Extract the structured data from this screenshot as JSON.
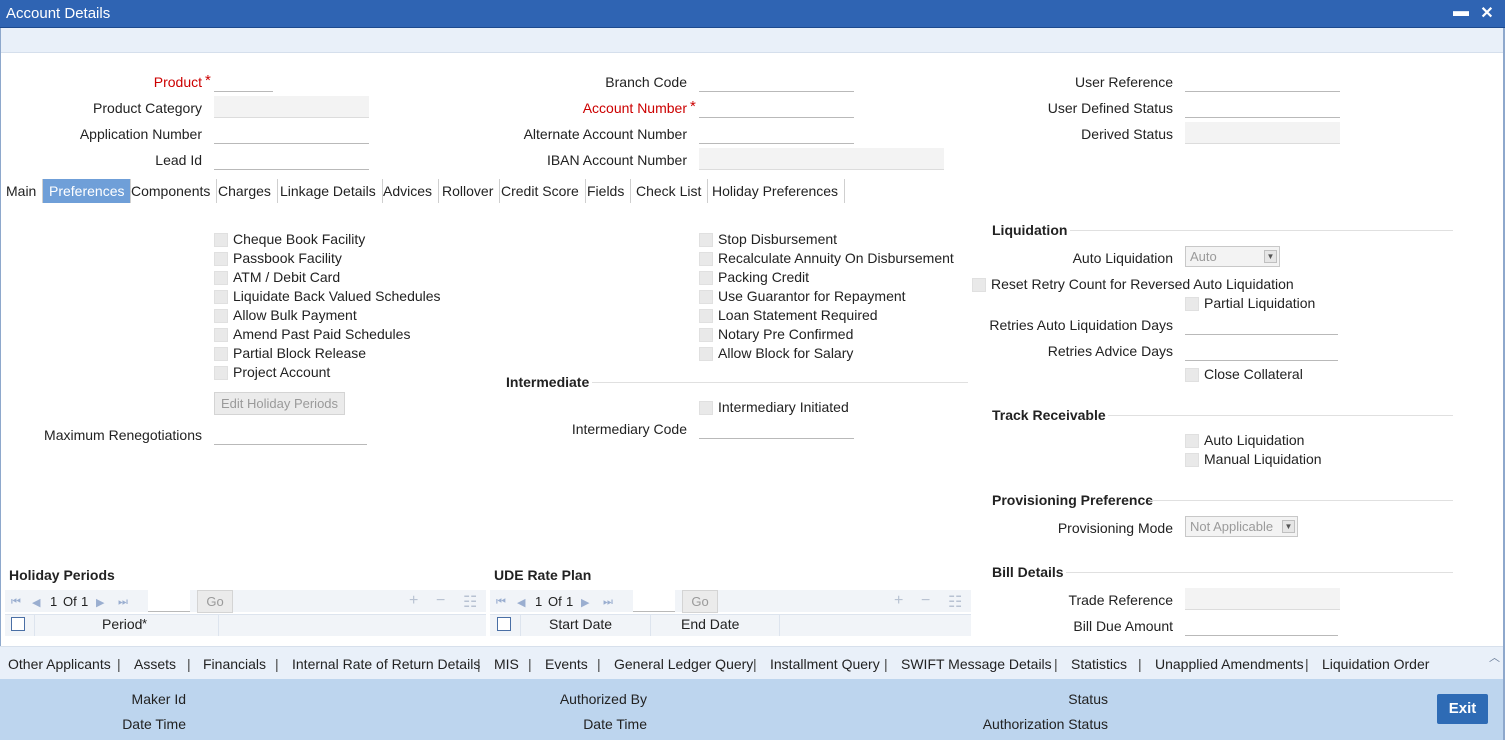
{
  "window": {
    "title": "Account Details",
    "minimize_glyph": "▬",
    "close_glyph": "✕"
  },
  "header_fields": {
    "product": "Product",
    "product_category": "Product Category",
    "application_number": "Application Number",
    "lead_id": "Lead Id",
    "branch_code": "Branch Code",
    "account_number": "Account Number",
    "alternate_account_number": "Alternate Account Number",
    "iban_account_number": "IBAN Account Number",
    "user_reference": "User Reference",
    "user_defined_status": "User Defined Status",
    "derived_status": "Derived Status",
    "required_mark": "*"
  },
  "tabs": [
    "Main",
    "Preferences",
    "Components",
    "Charges",
    "Linkage Details",
    "Advices",
    "Rollover",
    "Credit Score",
    "Fields",
    "Check List",
    "Holiday Preferences"
  ],
  "active_tab": "Preferences",
  "preferences": {
    "left_checks": [
      "Cheque Book Facility",
      "Passbook Facility",
      "ATM / Debit Card",
      "Liquidate Back Valued Schedules",
      "Allow Bulk Payment",
      "Amend Past Paid Schedules",
      "Partial Block Release",
      "Project Account"
    ],
    "edit_holiday_periods": "Edit Holiday Periods",
    "maximum_renegotiations": "Maximum Renegotiations",
    "middle_checks": [
      "Stop Disbursement",
      "Recalculate Annuity On Disbursement",
      "Packing Credit",
      "Use Guarantor for Repayment",
      "Loan Statement Required",
      "Notary Pre Confirmed",
      "Allow Block for Salary"
    ],
    "intermediate": {
      "title": "Intermediate",
      "intermediary_initiated": "Intermediary Initiated",
      "intermediary_code": "Intermediary Code"
    }
  },
  "liquidation": {
    "title": "Liquidation",
    "auto_liquidation_label": "Auto Liquidation",
    "auto_liquidation_value": "Auto",
    "reset_retry": "Reset Retry Count for Reversed Auto Liquidation",
    "partial_liquidation": "Partial Liquidation",
    "retries_auto_liquidation_days": "Retries Auto Liquidation Days",
    "retries_advice_days": "Retries Advice Days",
    "close_collateral": "Close Collateral"
  },
  "track_receivable": {
    "title": "Track Receivable",
    "auto_liquidation": "Auto Liquidation",
    "manual_liquidation": "Manual Liquidation"
  },
  "provisioning": {
    "title": "Provisioning Preference",
    "mode_label": "Provisioning Mode",
    "mode_value": "Not Applicable"
  },
  "bill_details": {
    "title": "Bill Details",
    "trade_reference": "Trade Reference",
    "bill_due_amount": "Bill Due Amount"
  },
  "holiday_periods": {
    "title": "Holiday Periods",
    "page_current": "1",
    "page_of": "Of",
    "page_total": "1",
    "go": "Go",
    "columns": [
      "Period"
    ]
  },
  "ude_rate_plan": {
    "title": "UDE Rate Plan",
    "page_current": "1",
    "page_of": "Of",
    "page_total": "1",
    "go": "Go",
    "columns": [
      "Start Date",
      "End Date"
    ]
  },
  "bottom_links": [
    "Other Applicants",
    "Assets",
    "Financials",
    "Internal Rate of Return Details",
    "MIS",
    "Events",
    "General Ledger Query",
    "Installment Query",
    "SWIFT Message Details",
    "Statistics",
    "Unapplied Amendments",
    "Liquidation Order"
  ],
  "footer": {
    "maker_id": "Maker Id",
    "date_time": "Date Time",
    "authorized_by": "Authorized By",
    "checker_date_time": "Date Time",
    "status": "Status",
    "authorization_status": "Authorization Status",
    "exit": "Exit"
  }
}
